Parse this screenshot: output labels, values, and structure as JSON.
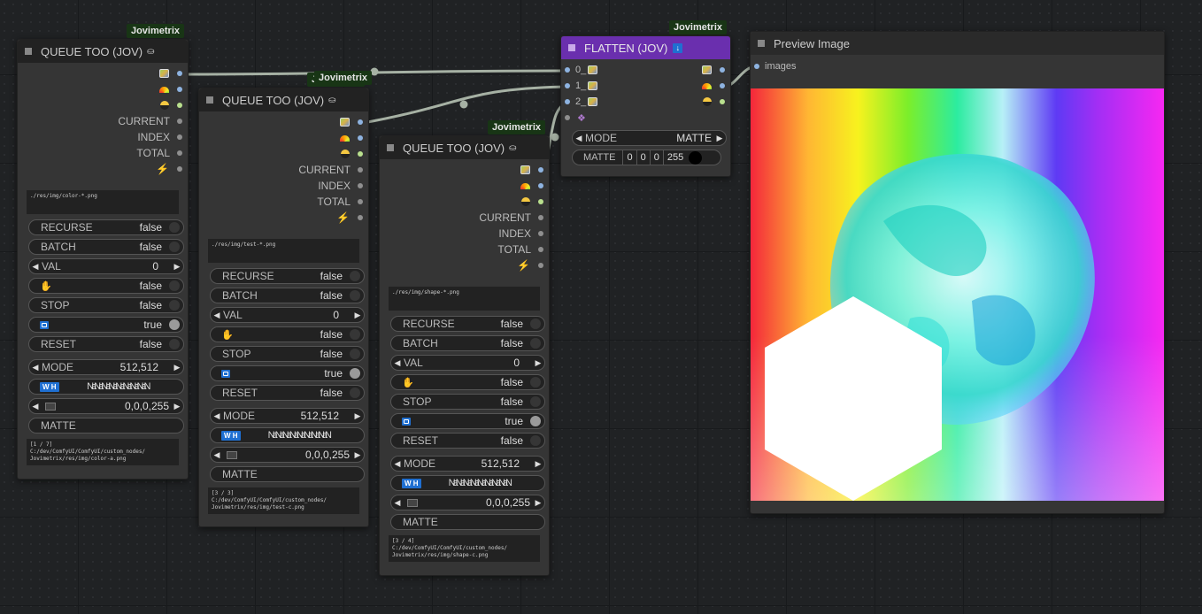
{
  "brand_badge": "Jovimetrix",
  "queue_nodes": [
    {
      "title": "QUEUE TOO (JOV)",
      "title_icon": "ufo-icon",
      "outputs": [
        {
          "icon": "image-icon"
        },
        {
          "icon": "rainbow-icon"
        },
        {
          "icon": "mask-icon"
        },
        {
          "label": "CURRENT"
        },
        {
          "label": "INDEX"
        },
        {
          "label": "TOTAL"
        },
        {
          "icon": "bolt-icon"
        }
      ],
      "path_text": "./res/img/color-*.png",
      "recurse": {
        "label": "RECURSE",
        "value": "false"
      },
      "batch": {
        "label": "BATCH",
        "value": "false"
      },
      "val": {
        "label": "VAL",
        "value": "0"
      },
      "hold": {
        "icon": "hand-icon",
        "value": "false"
      },
      "stop": {
        "label": "STOP",
        "value": "false"
      },
      "loop": {
        "icon": "loop-icon",
        "value": "true"
      },
      "reset": {
        "label": "RESET",
        "value": "false"
      },
      "mode": {
        "label": "MODE",
        "value": "512,512"
      },
      "wh": {
        "tag": "W H",
        "value": "NaNaNaNaNaNaNaNaN"
      },
      "matte_rgba": {
        "value": "0,0,0,255"
      },
      "matte": {
        "label": "MATTE"
      },
      "footer_line1": "[1 / 7]",
      "footer_line2": "C:/dev/ComfyUI/ComfyUI/custom_nodes/",
      "footer_line3": "Jovimetrix/res/img/color-a.png"
    },
    {
      "title": "QUEUE TOO (JOV)",
      "title_icon": "ufo-icon",
      "outputs": [
        {
          "icon": "image-icon"
        },
        {
          "icon": "rainbow-icon"
        },
        {
          "icon": "mask-icon"
        },
        {
          "label": "CURRENT"
        },
        {
          "label": "INDEX"
        },
        {
          "label": "TOTAL"
        },
        {
          "icon": "bolt-icon"
        }
      ],
      "path_text": "./res/img/test-*.png",
      "recurse": {
        "label": "RECURSE",
        "value": "false"
      },
      "batch": {
        "label": "BATCH",
        "value": "false"
      },
      "val": {
        "label": "VAL",
        "value": "0"
      },
      "hold": {
        "icon": "hand-icon",
        "value": "false"
      },
      "stop": {
        "label": "STOP",
        "value": "false"
      },
      "loop": {
        "icon": "loop-icon",
        "value": "true"
      },
      "reset": {
        "label": "RESET",
        "value": "false"
      },
      "mode": {
        "label": "MODE",
        "value": "512,512"
      },
      "wh": {
        "tag": "W H",
        "value": "NaNaNaNaNaNaNaNaN"
      },
      "matte_rgba": {
        "value": "0,0,0,255"
      },
      "matte": {
        "label": "MATTE"
      },
      "footer_line1": "[3 / 3]",
      "footer_line2": "C:/dev/ComfyUI/ComfyUI/custom_nodes/",
      "footer_line3": "Jovimetrix/res/img/test-c.png"
    },
    {
      "title": "QUEUE TOO (JOV)",
      "title_icon": "ufo-icon",
      "outputs": [
        {
          "icon": "image-icon"
        },
        {
          "icon": "rainbow-icon"
        },
        {
          "icon": "mask-icon"
        },
        {
          "label": "CURRENT"
        },
        {
          "label": "INDEX"
        },
        {
          "label": "TOTAL"
        },
        {
          "icon": "bolt-icon"
        }
      ],
      "path_text": "./res/img/shape-*.png",
      "recurse": {
        "label": "RECURSE",
        "value": "false"
      },
      "batch": {
        "label": "BATCH",
        "value": "false"
      },
      "val": {
        "label": "VAL",
        "value": "0"
      },
      "hold": {
        "icon": "hand-icon",
        "value": "false"
      },
      "stop": {
        "label": "STOP",
        "value": "false"
      },
      "loop": {
        "icon": "loop-icon",
        "value": "true"
      },
      "reset": {
        "label": "RESET",
        "value": "false"
      },
      "mode": {
        "label": "MODE",
        "value": "512,512"
      },
      "wh": {
        "tag": "W H",
        "value": "NaNaNaNaNaNaNaNaN"
      },
      "matte_rgba": {
        "value": "0,0,0,255"
      },
      "matte": {
        "label": "MATTE"
      },
      "footer_line1": "[3 / 4]",
      "footer_line2": "C:/dev/ComfyUI/ComfyUI/custom_nodes/",
      "footer_line3": "Jovimetrix/res/img/shape-c.png"
    }
  ],
  "flatten": {
    "title": "FLATTEN (JOV)",
    "title_color": "#6a2fae",
    "inputs": [
      {
        "label": "0_"
      },
      {
        "label": "1_"
      },
      {
        "label": "2_"
      }
    ],
    "mode": {
      "label": "MODE",
      "value": "MATTE"
    },
    "matte": {
      "label": "MATTE",
      "r": "0",
      "g": "0",
      "b": "0",
      "a": "255"
    }
  },
  "preview": {
    "title": "Preview Image",
    "input_label": "images"
  },
  "colors": {
    "canvas": "#202224",
    "node_body": "#353535",
    "node_title": "#222222",
    "badge": "#183515",
    "wire": "#a6b1a4"
  }
}
